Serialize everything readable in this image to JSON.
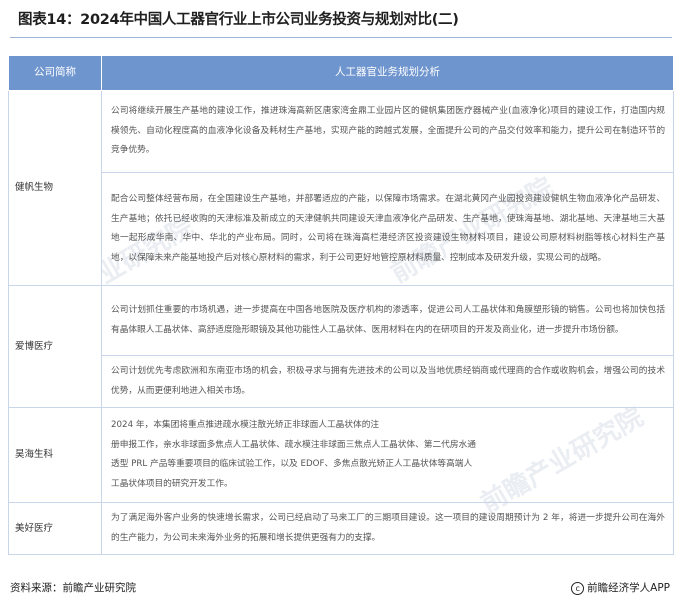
{
  "title": "图表14：2024年中国人工器官行业上市公司业务投资与规划对比(二)",
  "table": {
    "headers": [
      "公司简称",
      "人工器官业务规划分析"
    ],
    "rows": [
      {
        "company": "健帆生物",
        "desc": "公司将继续开展生产基地的建设工作，推进珠海高新区唐家湾金鼎工业园片区的健帆集团医疗器械产业(血液净化)项目的建设工作，打造国内规模领先、自动化程度高的血液净化设备及耗材生产基地，实现产能的跨越式发展，全面提升公司的产品交付效率和能力，提升公司在制造环节的竞争优势。"
      },
      {
        "desc": "配合公司整体经营布局，在全国建设生产基地，并部署适应的产能，以保障市场需求。在湖北黄冈产业园投资建设健帆生物血液净化产品研发、生产基地；依托已经收购的天津标准及新成立的天津健帆共同建设天津血液净化产品研发、生产基地，使珠海基地、湖北基地、天津基地三大基地一起形成华南、华中、华北的产业布局。同时，公司将在珠海高栏港经济区投资建设生物材料项目，建设公司原材料树脂等核心材料生产基地，以保障未来产能基地投产后对核心原材料的需求，利于公司更好地管控原材料质量、控制成本及研发升级，实现公司的战略。"
      },
      {
        "company": "爱博医疗",
        "desc": "公司计划抓住重要的市场机遇，进一步提高在中国各地医院及医疗机构的渗透率，促进公司人工晶状体和角膜塑形镜的销售。公司也将加快包括有晶体眼人工晶状体、高舒适度隐形眼镜及其他功能性人工晶状体、医用材料在内的在研项目的开发及商业化，进一步提升市场份额。"
      },
      {
        "desc": "公司计划优先考虑欧洲和东南亚市场的机会，积极寻求与拥有先进技术的公司以及当地优质经销商或代理商的合作或收购机会，增强公司的技术优势，从而更便利地进入相关市场。"
      },
      {
        "company": "昊海生科",
        "desc_lines": [
          "2024 年，本集团将重点推进疏水模注散光矫正非球面人工晶状体的注",
          "册申报工作，亲水非球面多焦点人工晶状体、疏水模注非球面三焦点人工晶状体、第二代房水通",
          "透型 PRL 产品等重要项目的临床试验工作，以及 EDOF、多焦点散光矫正人工晶状体等高端人",
          "工晶状体项目的研究开发工作。"
        ]
      },
      {
        "company": "美好医疗",
        "desc": "为了满足海外客户业务的快速增长需求，公司已经启动了马来工厂的三期项目建设。这一项目的建设周期预计为 2 年，将进一步提升公司在海外的生产能力，为公司未来海外业务的拓展和增长提供更强有力的支撑。"
      }
    ]
  },
  "footer": {
    "source": "资料来源：前瞻产业研究院",
    "copyright_symbol": "c",
    "brand": "前瞻经济学人APP"
  },
  "watermark": {
    "text": "前瞻产业研究院"
  },
  "colors": {
    "header_bg": "#6f95cf",
    "border": "#c9d6ea",
    "title_rule": "#9db6d8"
  }
}
